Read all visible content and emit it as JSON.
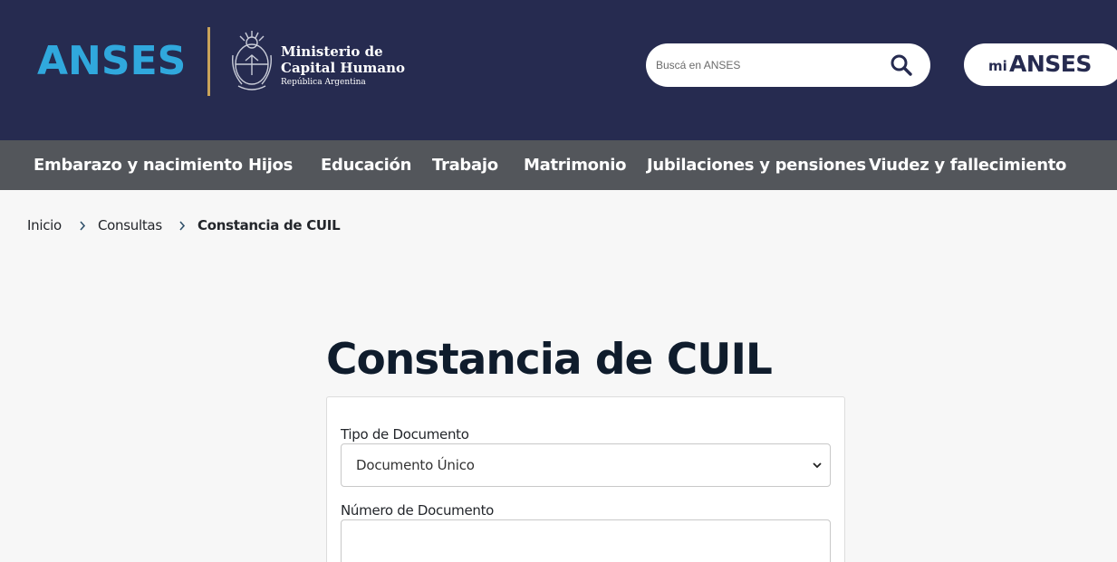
{
  "header": {
    "logo_text": "ANSES",
    "ministry_line1": "Ministerio de",
    "ministry_line2": "Capital Humano",
    "ministry_line3": "República Argentina",
    "search_placeholder": "Buscá en ANSES",
    "mi_prefix": "mi",
    "mi_label": "ANSES"
  },
  "nav": {
    "items": [
      {
        "label": "Embarazo y nacimiento"
      },
      {
        "label": "Hijos"
      },
      {
        "label": "Educación"
      },
      {
        "label": "Trabajo"
      },
      {
        "label": "Matrimonio"
      },
      {
        "label": "Jubilaciones y pensiones"
      },
      {
        "label": "Viudez y fallecimiento"
      }
    ]
  },
  "breadcrumb": {
    "items": [
      "Inicio",
      "Consultas",
      "Constancia de CUIL"
    ]
  },
  "page": {
    "title": "Constancia de CUIL"
  },
  "form": {
    "doc_type_label": "Tipo de Documento",
    "doc_type_value": "Documento Único",
    "doc_number_label": "Número de Documento",
    "doc_number_value": ""
  },
  "colors": {
    "header_bg": "#262b50",
    "nav_bg": "#53565b",
    "logo_blue": "#30a8dd",
    "divider_gold": "#c9a35a"
  }
}
